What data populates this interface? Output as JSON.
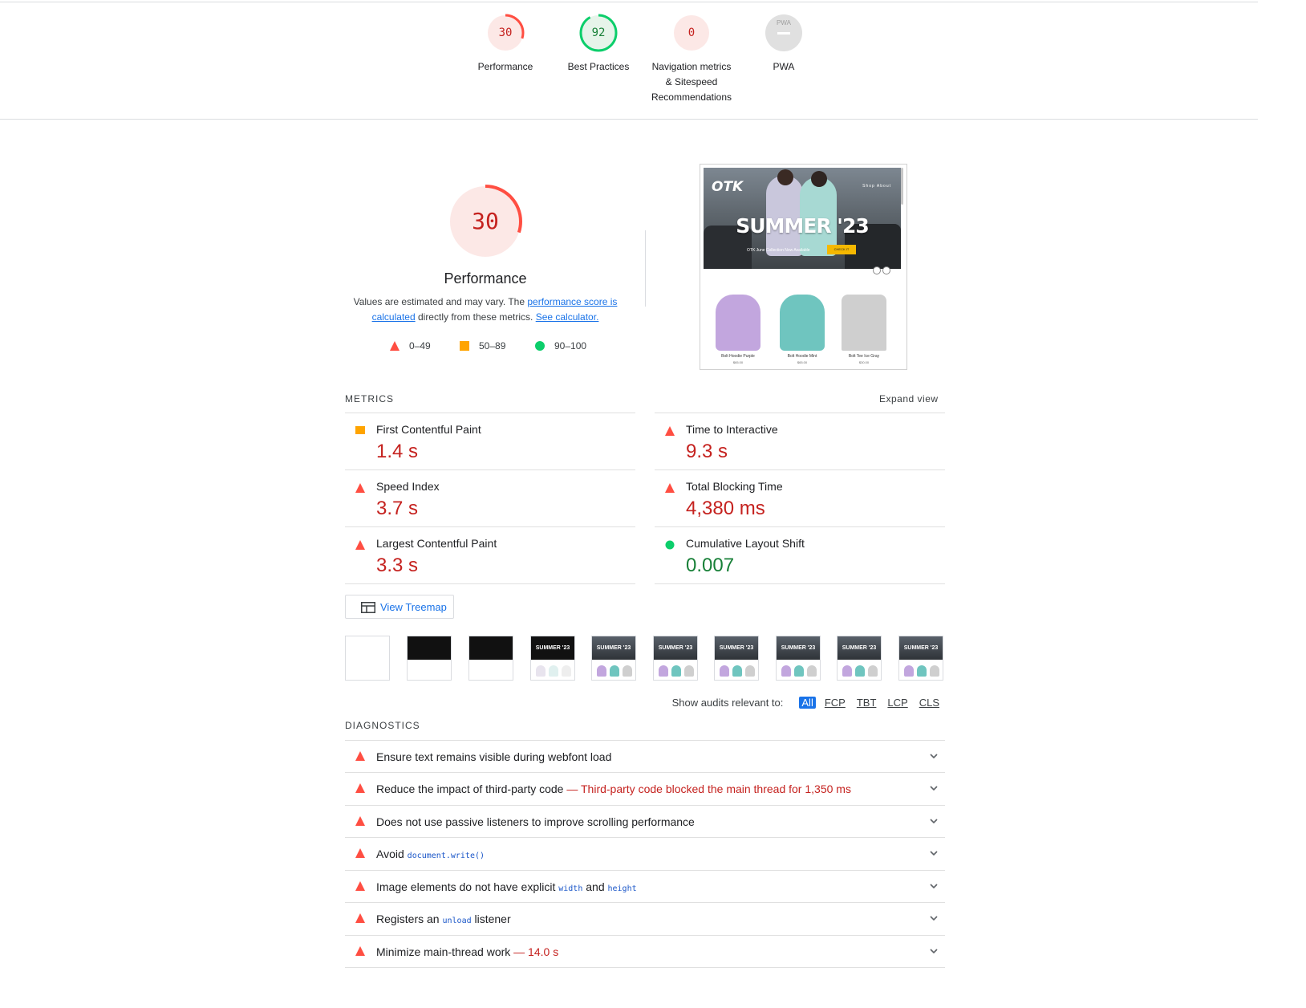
{
  "top_gauges": [
    {
      "score": "30",
      "label": "Performance",
      "status": "fail",
      "fraction": 0.3
    },
    {
      "score": "92",
      "label": "Best Practices",
      "status": "pass",
      "fraction": 0.92
    },
    {
      "score": "0",
      "label": "Navigation metrics & Sitespeed Recommendations",
      "status": "fail",
      "fraction": 0.0
    },
    {
      "score": "PWA",
      "label": "PWA",
      "status": "na",
      "fraction": 0.0
    }
  ],
  "performance": {
    "score": "30",
    "fraction": 0.3,
    "title": "Performance",
    "desc_prefix": "Values are estimated and may vary. The ",
    "desc_link1": "performance score is calculated",
    "desc_middle": " directly from these metrics. ",
    "desc_link2": "See calculator."
  },
  "legend": {
    "fail": "0–49",
    "average": "50–89",
    "pass": "90–100"
  },
  "screenshot": {
    "logo": "OTK",
    "nav": "Shop   About",
    "hero_title": "SUMMER '23",
    "hero_sub": "OTK June Collection Now Available",
    "hero_cta": "CHECK IT",
    "products": [
      {
        "name": "Bolt Hoodie Purple",
        "price": "$65.00"
      },
      {
        "name": "Bolt Hoodie Mint",
        "price": "$65.00"
      },
      {
        "name": "Bolt Tee Ice Gray",
        "price": "$30.00"
      }
    ]
  },
  "metrics": {
    "section_label": "METRICS",
    "expand_label": "Expand view",
    "items": [
      {
        "name": "First Contentful Paint",
        "value": "1.4 s",
        "status": "average"
      },
      {
        "name": "Time to Interactive",
        "value": "9.3 s",
        "status": "fail"
      },
      {
        "name": "Speed Index",
        "value": "3.7 s",
        "status": "fail"
      },
      {
        "name": "Total Blocking Time",
        "value": "4,380 ms",
        "status": "fail"
      },
      {
        "name": "Largest Contentful Paint",
        "value": "3.3 s",
        "status": "fail"
      },
      {
        "name": "Cumulative Layout Shift",
        "value": "0.007",
        "status": "pass"
      }
    ]
  },
  "treemap": {
    "label": "View Treemap"
  },
  "filmstrip_title": "SUMMER '23",
  "filter": {
    "label": "Show audits relevant to:",
    "chips": [
      "All",
      "FCP",
      "TBT",
      "LCP",
      "CLS"
    ],
    "active": "All"
  },
  "diagnostics": {
    "section_label": "DIAGNOSTICS",
    "items": [
      {
        "text": "Ensure text remains visible during webfont load"
      },
      {
        "text": "Reduce the impact of third-party code",
        "note": "— Third-party code blocked the main thread for 1,350 ms"
      },
      {
        "text": "Does not use passive listeners to improve scrolling performance"
      },
      {
        "text": "Avoid ",
        "code": "document.write()"
      },
      {
        "text": "Image elements do not have explicit ",
        "code": "width",
        "text2": " and ",
        "code2": "height"
      },
      {
        "text": "Registers an ",
        "code": "unload",
        "text2": " listener"
      },
      {
        "text": "Minimize main-thread work",
        "note": "— 14.0 s"
      }
    ]
  },
  "colors": {
    "fail": "#ff4e42",
    "fail_text": "#c5221f",
    "average": "#ffa400",
    "pass": "#0cce6b",
    "pass_text": "#188038",
    "link": "#1a73e8"
  }
}
